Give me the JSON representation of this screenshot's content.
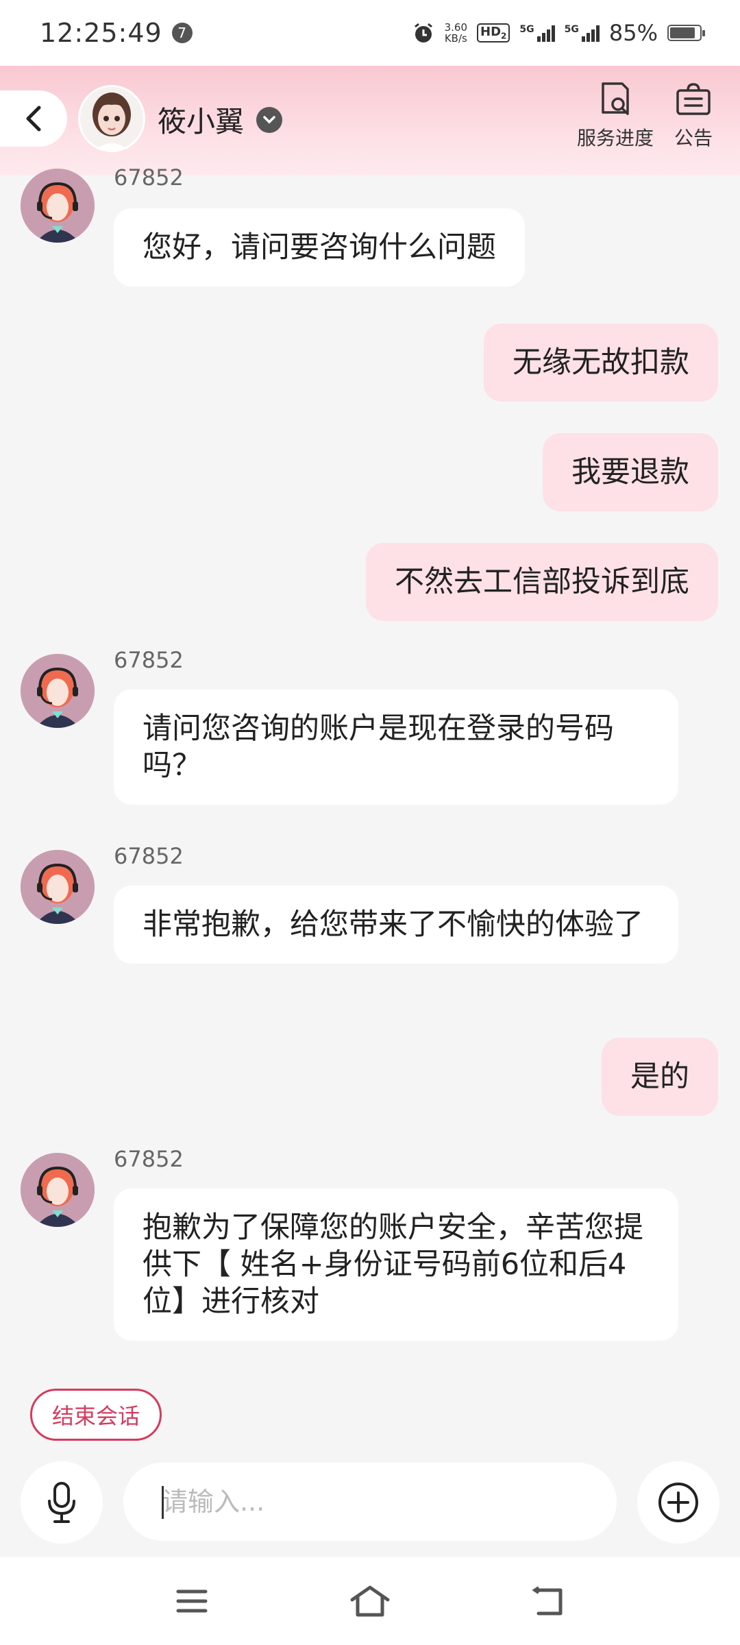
{
  "status_bar": {
    "time": "12:25:49",
    "notification_count": "7",
    "net_speed_value": "3.60",
    "net_speed_unit": "KB/s",
    "hd_label": "HD",
    "hd_sub": "2",
    "sim1_label": "5G",
    "sim2_label": "5G",
    "battery_percent": "85%",
    "battery_level": 0.85
  },
  "header": {
    "title": "筱小翼",
    "actions": [
      {
        "label": "服务进度",
        "icon": "service-progress-icon"
      },
      {
        "label": "公告",
        "icon": "announcement-icon"
      }
    ]
  },
  "messages": [
    {
      "from": "agent",
      "name": "67852",
      "text": "您好，请问要咨询什么问题"
    },
    {
      "from": "user",
      "text": "无缘无故扣款"
    },
    {
      "from": "user",
      "text": "我要退款"
    },
    {
      "from": "user",
      "text": "不然去工信部投诉到底"
    },
    {
      "from": "agent",
      "name": "67852",
      "text": "请问您咨询的账户是现在登录的号码吗？"
    },
    {
      "from": "agent",
      "name": "67852",
      "text": "非常抱歉，给您带来了不愉快的体验了"
    },
    {
      "from": "user",
      "text": "是的"
    },
    {
      "from": "agent",
      "name": "67852",
      "text": "抱歉为了保障您的账户安全，辛苦您提供下【 姓名+身份证号码前6位和后4位】进行核对"
    }
  ],
  "end_chat_label": "结束会话",
  "input": {
    "placeholder": "请输入...",
    "value": ""
  }
}
